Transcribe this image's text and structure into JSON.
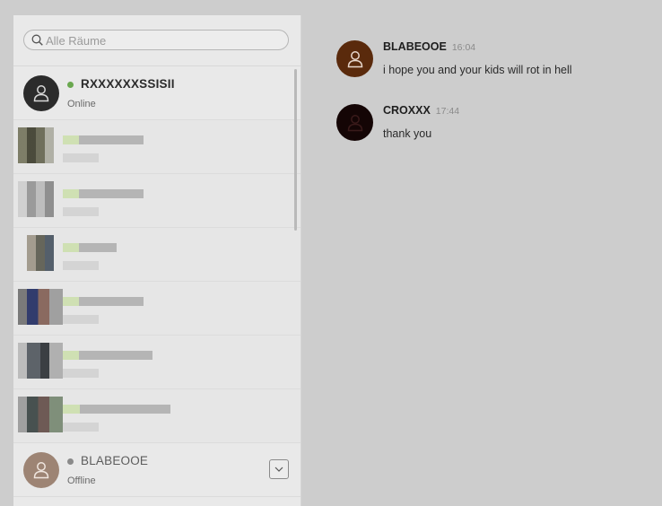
{
  "search": {
    "placeholder": "Alle Räume"
  },
  "contacts": [
    {
      "name": "RXXXXXXSSISII",
      "status": "Online",
      "status_color": "#6aa84f"
    },
    {
      "name": "BLABEOOE",
      "status": "Offline",
      "status_color": "#8a8a8a"
    }
  ],
  "messages": [
    {
      "author": "BLABEOOE",
      "time": "16:04",
      "text": "i hope you and your kids will rot in hell",
      "avatar_color": "#5a2a0c"
    },
    {
      "author": "CROXXX",
      "time": "17:44",
      "text": "thank you",
      "avatar_color": "#140505"
    }
  ]
}
